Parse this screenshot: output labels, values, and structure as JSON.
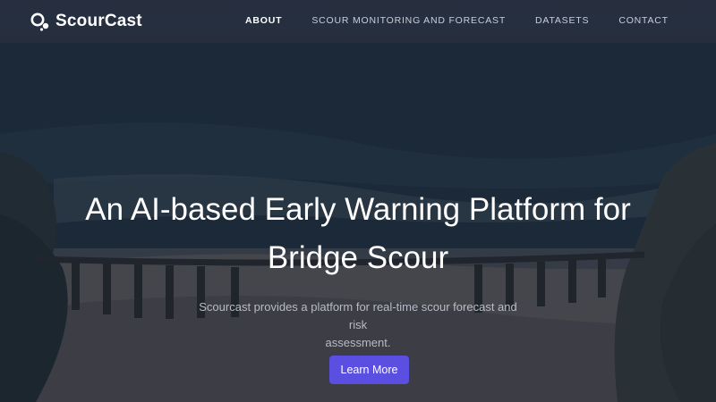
{
  "brand": {
    "name": "ScourCast",
    "logo_icon": "scourcast-logo-icon"
  },
  "nav": {
    "items": [
      {
        "label": "ABOUT",
        "active": true
      },
      {
        "label": "SCOUR MONITORING AND FORECAST",
        "active": false
      },
      {
        "label": "DATASETS",
        "active": false
      },
      {
        "label": "CONTACT",
        "active": false
      }
    ]
  },
  "hero": {
    "title_line1": "An AI-based Early Warning Platform for",
    "title_line2": "Bridge Scour",
    "subtitle_line1": "Scourcast provides a platform for real-time scour forecast and risk",
    "subtitle_line2": "assessment.",
    "cta_label": "Learn More",
    "background": "coastal bridge photo"
  },
  "colors": {
    "accent": "#5a4fe0",
    "nav_bg": "#2a3242",
    "text_primary": "#ffffff",
    "text_muted": "#b7bcc6"
  }
}
